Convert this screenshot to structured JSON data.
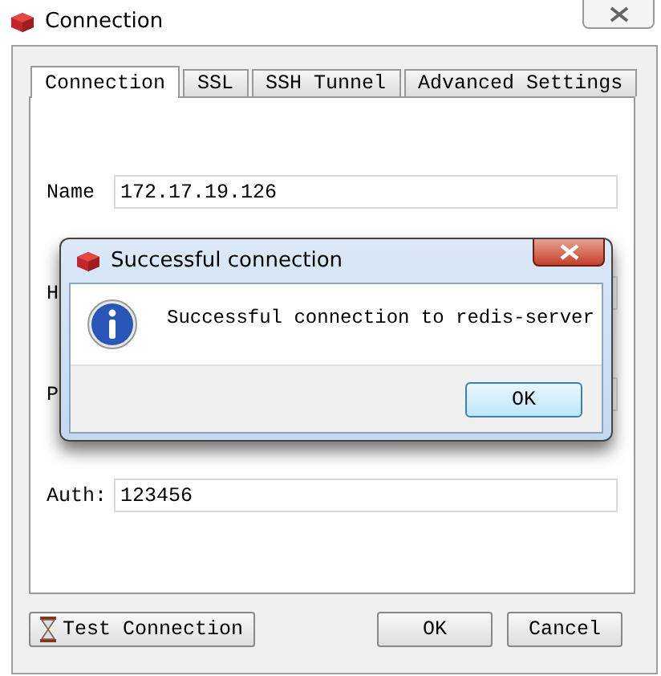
{
  "window": {
    "title": "Connection"
  },
  "tabs": [
    {
      "label": "Connection",
      "selected": true
    },
    {
      "label": "SSL",
      "selected": false
    },
    {
      "label": "SSH Tunnel",
      "selected": false
    },
    {
      "label": "Advanced Settings",
      "selected": false
    }
  ],
  "fields": [
    {
      "label": "Name",
      "value": "172.17.19.126"
    },
    {
      "label": "H"
    },
    {
      "label": "P"
    },
    {
      "label": "Auth:",
      "value": "123456"
    }
  ],
  "buttons": {
    "test": "Test Connection",
    "ok": "OK",
    "cancel": "Cancel"
  },
  "dialog": {
    "title": "Successful connection",
    "message": "Successful connection to redis-server",
    "button": "OK"
  }
}
